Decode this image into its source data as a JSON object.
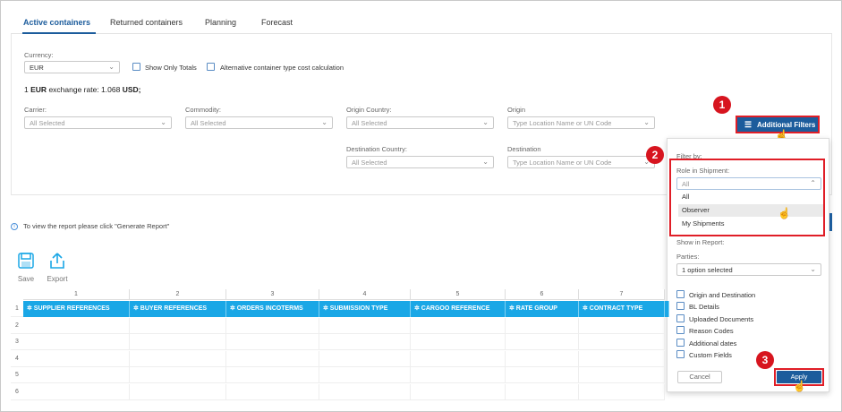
{
  "tabs": [
    {
      "label": "Active containers",
      "active": true
    },
    {
      "label": "Returned containers"
    },
    {
      "label": "Planning"
    },
    {
      "label": "Forecast"
    }
  ],
  "currency": {
    "label": "Currency:",
    "value": "EUR"
  },
  "show_only_totals": "Show Only Totals",
  "alt_cost_calc": "Alternative container type cost calculation",
  "exchange": {
    "prefix": "1",
    "cur": "EUR",
    "mid": "exchange rate: 1.068",
    "to": "USD;"
  },
  "filters": {
    "carrier": {
      "label": "Carrier:",
      "value": "All Selected"
    },
    "commodity": {
      "label": "Commodity:",
      "value": "All Selected"
    },
    "origin_country": {
      "label": "Origin Country:",
      "value": "All Selected"
    },
    "origin": {
      "label": "Origin",
      "placeholder": "Type Location Name or UN Code"
    },
    "destination_country": {
      "label": "Destination Country:",
      "value": "All Selected"
    },
    "destination": {
      "label": "Destination",
      "placeholder": "Type Location Name or UN Code"
    }
  },
  "additional_filters_label": "Additional Filters",
  "badges": [
    "1",
    "2",
    "3"
  ],
  "dropdown": {
    "filter_by": "Filter by:",
    "role_label": "Role in Shipment:",
    "role_value": "All",
    "role_options": [
      "All",
      "Observer",
      "My Shipments"
    ],
    "show_in_report": "Show in Report:",
    "parties_label": "Parties:",
    "parties_value": "1 option selected",
    "checks": [
      "Origin and Destination",
      "BL Details",
      "Uploaded Documents",
      "Reason Codes",
      "Additional dates",
      "Custom Fields"
    ],
    "cancel": "Cancel",
    "apply": "Apply"
  },
  "info_text": "To view the report please click \"Generate Report\"",
  "toolbar": {
    "save": "Save",
    "export": "Export"
  },
  "grid": {
    "col_numbers": [
      "1",
      "2",
      "3",
      "4",
      "5",
      "6",
      "7"
    ],
    "row_numbers": [
      "1",
      "2",
      "3",
      "4",
      "5",
      "6"
    ],
    "headers": [
      "SUPPLIER REFERENCES",
      "BUYER REFERENCES",
      "ORDERS INCOTERMS",
      "SUBMISSION TYPE",
      "CARGOO REFERENCE",
      "RATE GROUP",
      "CONTRACT TYPE"
    ]
  },
  "colors": {
    "primary": "#1c5c9c",
    "header_blue": "#1aa7e6",
    "annotation_red": "#d7151f"
  }
}
